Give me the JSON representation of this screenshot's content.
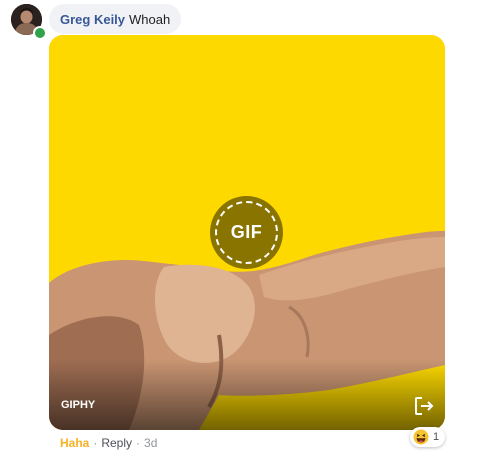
{
  "comment": {
    "author": "Greg Keily",
    "text": "Whoah",
    "gif": {
      "play_label": "GIF",
      "provider": "GIPHY",
      "background_color": "#fdd900"
    },
    "actions": {
      "reaction_label": "Haha",
      "reply_label": "Reply",
      "timestamp": "3d"
    },
    "reactions": {
      "count": "1",
      "type": "haha-emoji-icon"
    },
    "author_online": true
  },
  "colors": {
    "author_link": "#385898",
    "haha_accent": "#f7b125",
    "presence": "#31a24c",
    "bubble_bg": "#f0f2f5"
  }
}
